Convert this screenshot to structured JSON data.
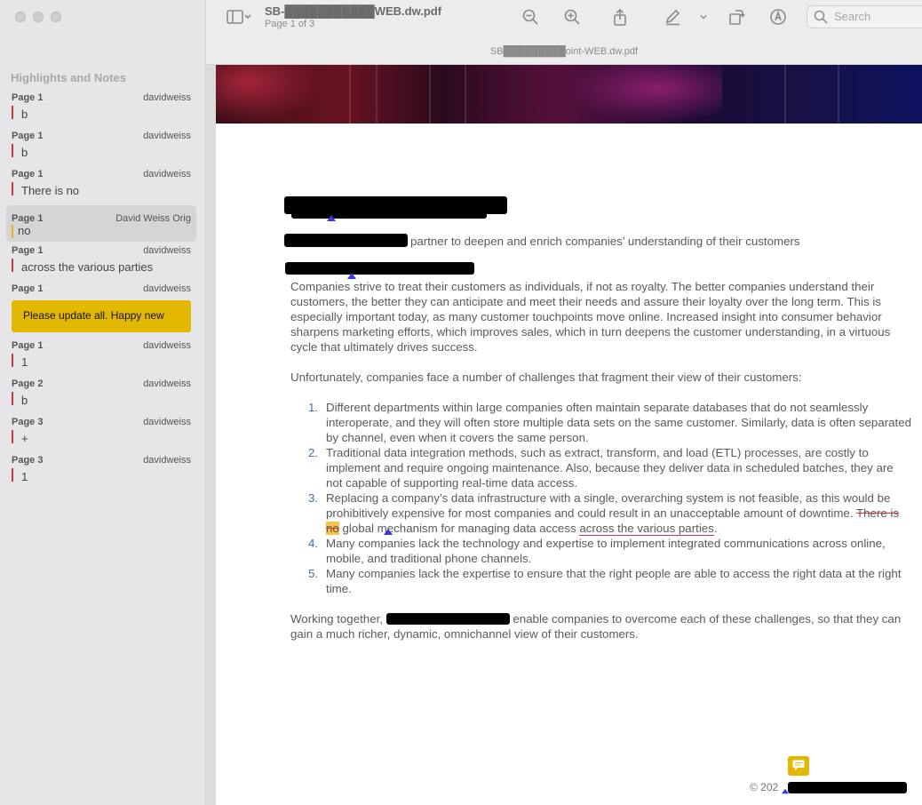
{
  "window": {
    "doc_title": "SB-███████████WEB.dw.pdf",
    "page_indicator": "Page 1 of 3",
    "tab_title": "SB█████████oint-WEB.dw.pdf"
  },
  "toolbar": {
    "search_placeholder": "Search",
    "icons": [
      "sidebar-icon",
      "zoom-out-icon",
      "zoom-in-icon",
      "share-icon",
      "markup-pen-icon",
      "rotate-icon",
      "annotate-icon",
      "search-icon"
    ]
  },
  "sidebar": {
    "title": "Highlights and Notes",
    "notes": [
      {
        "page": "Page 1",
        "author": "davidweiss",
        "text": "b"
      },
      {
        "page": "Page 1",
        "author": "davidweiss",
        "text": "b"
      },
      {
        "page": "Page 1",
        "author": "davidweiss",
        "text": "There is no"
      },
      {
        "page": "Page 1",
        "author": "David Weiss Orig",
        "text": "no"
      },
      {
        "page": "Page 1",
        "author": "davidweiss",
        "text": "across the various parties"
      },
      {
        "page": "Page 1",
        "author": "davidweiss",
        "text": "Please update all. Happy new"
      },
      {
        "page": "Page 1",
        "author": "davidweiss",
        "text": "1"
      },
      {
        "page": "Page 2",
        "author": "davidweiss",
        "text": "b"
      },
      {
        "page": "Page 3",
        "author": "davidweiss",
        "text": "+"
      },
      {
        "page": "Page 3",
        "author": "davidweiss",
        "text": "1"
      }
    ]
  },
  "document": {
    "tagline": "partner to deepen and enrich companies’ understanding of their customers",
    "para1": "Companies strive to treat their customers as individuals, if not as royalty. The better companies understand their customers, the better they can anticipate and meet their needs and assure their loyalty over the long term. This is especially important today, as many customer touchpoints move online. Increased insight into consumer behavior sharpens marketing efforts, which improves sales, which in turn deepens the customer understanding, in a virtuous cycle that ultimately drives success.",
    "para2": "Unfortunately, companies face a number of challenges that fragment their view of their customers:",
    "list": [
      {
        "num": "1.",
        "text": "Different departments within large companies often maintain separate databases that do not seamlessly interoperate, and they will often store multiple data sets on the same customer. Similarly, data is often separated by channel, even when it covers the same person."
      },
      {
        "num": "2.",
        "text": "Traditional data integration methods, such as extract, transform, and load (ETL) processes, are costly to implement and require ongoing maintenance. Also, because they deliver data in scheduled batches, they are not capable of supporting real-time data access."
      },
      {
        "num": "3.",
        "text_a": "Replacing a company’s data infrastructure with a single, overarching system is not feasible, as this would be prohibitively expensive for most companies and could result in an unacceptable amount of downtime. ",
        "text_strike1": "There is ",
        "text_hl": "no",
        "text_b": " global mechanism for managing data access ",
        "text_strike2": "across the various parties",
        "text_c": "."
      },
      {
        "num": "4.",
        "text": "Many companies lack the technology and expertise to implement integrated communications across online, mobile, and traditional phone channels."
      },
      {
        "num": "5.",
        "text": "Many companies lack the expertise to ensure that the right people are able to access the right data at the right time."
      }
    ],
    "para3_a": "Working together, ",
    "para3_b": " enable companies to overcome each of these challenges, so that they can gain a much richer, dynamic, omnichannel view of their customers.",
    "copyright": "© 202"
  }
}
